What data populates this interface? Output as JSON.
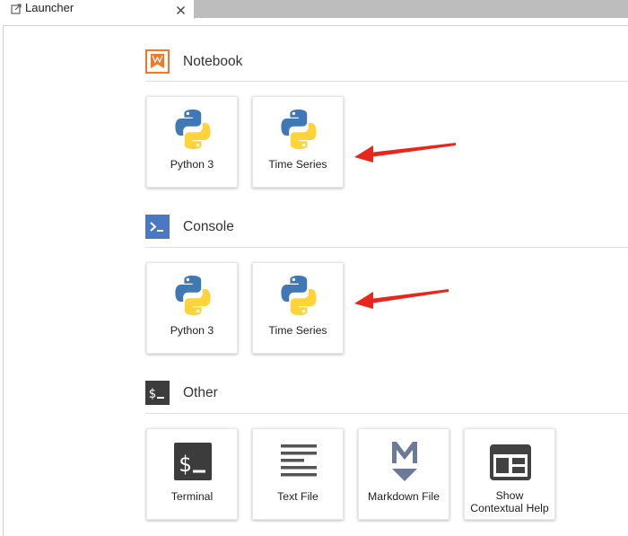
{
  "tab": {
    "label": "Launcher"
  },
  "sections": {
    "notebook": {
      "title": "Notebook",
      "cards": [
        {
          "label": "Python 3"
        },
        {
          "label": "Time Series"
        }
      ]
    },
    "console": {
      "title": "Console",
      "cards": [
        {
          "label": "Python 3"
        },
        {
          "label": "Time Series"
        }
      ]
    },
    "other": {
      "title": "Other",
      "cards": [
        {
          "label": "Terminal",
          "icon": "terminal-icon"
        },
        {
          "label": "Text File",
          "icon": "text-file-icon"
        },
        {
          "label": "Markdown File",
          "icon": "markdown-icon"
        },
        {
          "label": "Show\nContextual Help",
          "label_line1": "Show",
          "label_line2": "Contextual Help",
          "icon": "contextual-help-icon"
        }
      ]
    }
  },
  "icons": {
    "notebook_section": "notebook-icon",
    "console_section": "console-icon",
    "other_section": "terminal-icon",
    "kernel": "python-logo-icon",
    "annotation": "red-arrow"
  },
  "colors": {
    "notebook_orange": "#f37726",
    "console_blue": "#4a78c2",
    "terminal_dark": "#3c3c3c",
    "python_blue": "#3c74b4",
    "python_yellow": "#ffd743",
    "markdown_gray": "#6b7a99",
    "annotation_red": "#e8261c"
  }
}
